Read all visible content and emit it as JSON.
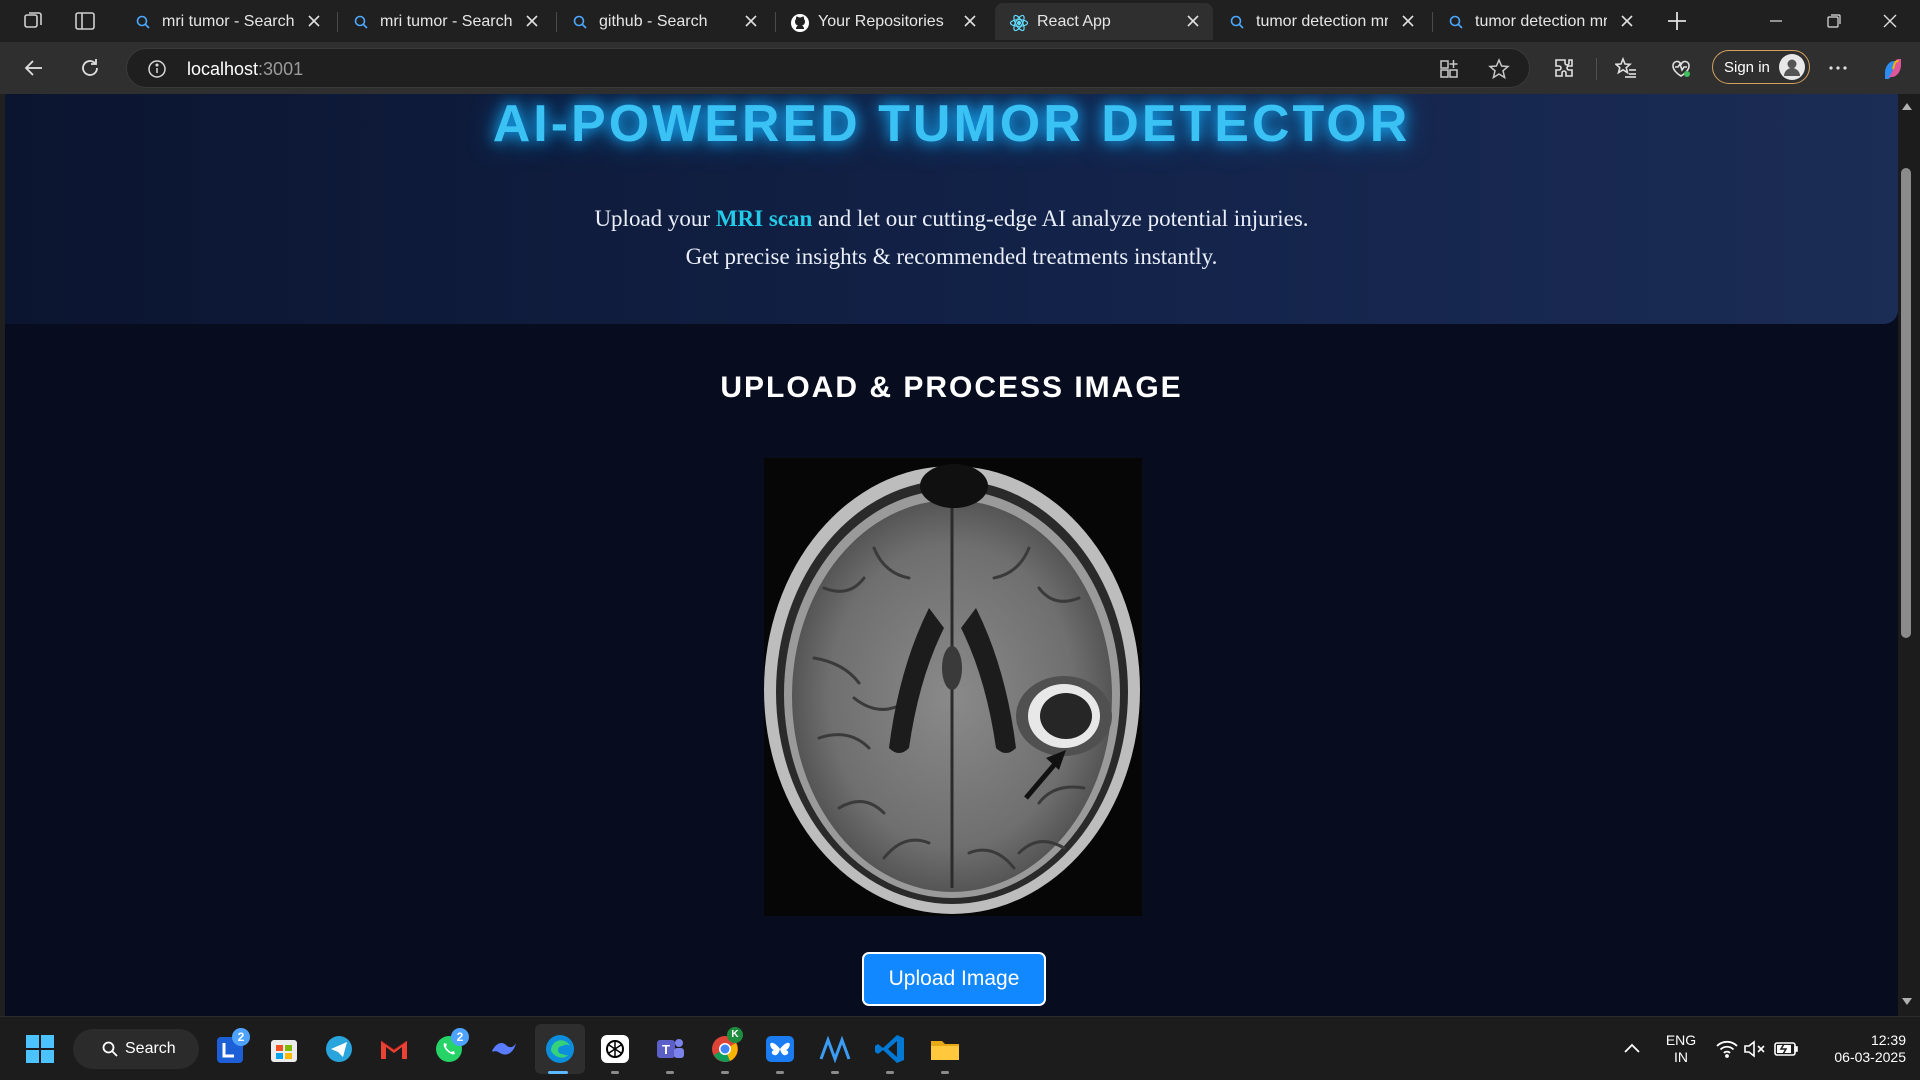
{
  "browser": {
    "tabs": [
      {
        "title": "mri tumor - Search",
        "icon": "search-icon",
        "active": false
      },
      {
        "title": "mri tumor - Search Images",
        "icon": "search-icon",
        "active": false
      },
      {
        "title": "github - Search",
        "icon": "search-icon",
        "active": false
      },
      {
        "title": "Your Repositories",
        "icon": "github-icon",
        "active": false
      },
      {
        "title": "React App",
        "icon": "react-icon",
        "active": true
      },
      {
        "title": "tumor detection mri images",
        "icon": "search-icon",
        "active": false
      },
      {
        "title": "tumor detection mri images",
        "icon": "search-icon",
        "active": false
      }
    ],
    "address": {
      "host": "localhost",
      "port": ":3001"
    },
    "signin_label": "Sign in"
  },
  "page": {
    "hero_title": "AI-POWERED TUMOR DETECTOR",
    "hero_line1_pre": "Upload your ",
    "hero_line1_highlight": "MRI scan",
    "hero_line1_post": " and let our cutting-edge AI analyze potential injuries.",
    "hero_line2": "Get precise insights & recommended treatments instantly.",
    "section_title": "UPLOAD & PROCESS IMAGE",
    "upload_button_label": "Upload Image"
  },
  "taskbar": {
    "search_label": "Search",
    "badges": {
      "launcher": "2",
      "whatsapp": "2",
      "chrome_profile": "K"
    },
    "language": {
      "line1": "ENG",
      "line2": "IN"
    },
    "clock": {
      "time": "12:39",
      "date": "06-03-2025"
    }
  },
  "colors": {
    "accent_title": "#3bc2f5",
    "highlight": "#23cbe8",
    "upload_button": "#1188ff",
    "page_background": "#070d1e"
  }
}
